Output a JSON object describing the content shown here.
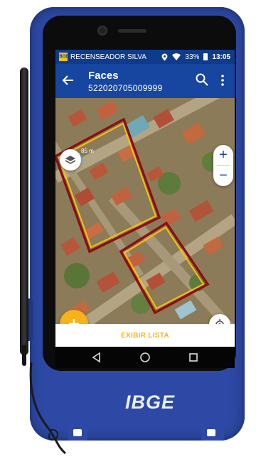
{
  "status_bar": {
    "app_name": "RECENSEADOR SILVA",
    "app_icon_text": "IBGE",
    "battery": "33%",
    "time": "13:05"
  },
  "app_bar": {
    "title": "Faces",
    "subtitle": "522020705009999",
    "icons": [
      "back-arrow-icon",
      "search-icon",
      "more-vert-icon"
    ]
  },
  "map": {
    "scale_label": "85 m",
    "controls": [
      "layers-icon",
      "zoom-in-icon",
      "zoom-out-icon",
      "my-location-icon",
      "fullscreen-exit-icon",
      "add-icon"
    ],
    "zoom_in_label": "+",
    "zoom_out_label": "−",
    "colors": {
      "face_fill_border": "#8b0f14",
      "face_outline": "#f5c400",
      "accent": "#f6b21b",
      "app_bar": "#1646a0"
    }
  },
  "list_button": {
    "label": "EXIBIR LISTA"
  },
  "nav": [
    "back-triangle-icon",
    "home-circle-icon",
    "recents-square-icon"
  ],
  "device": {
    "logo": "IBGE"
  }
}
